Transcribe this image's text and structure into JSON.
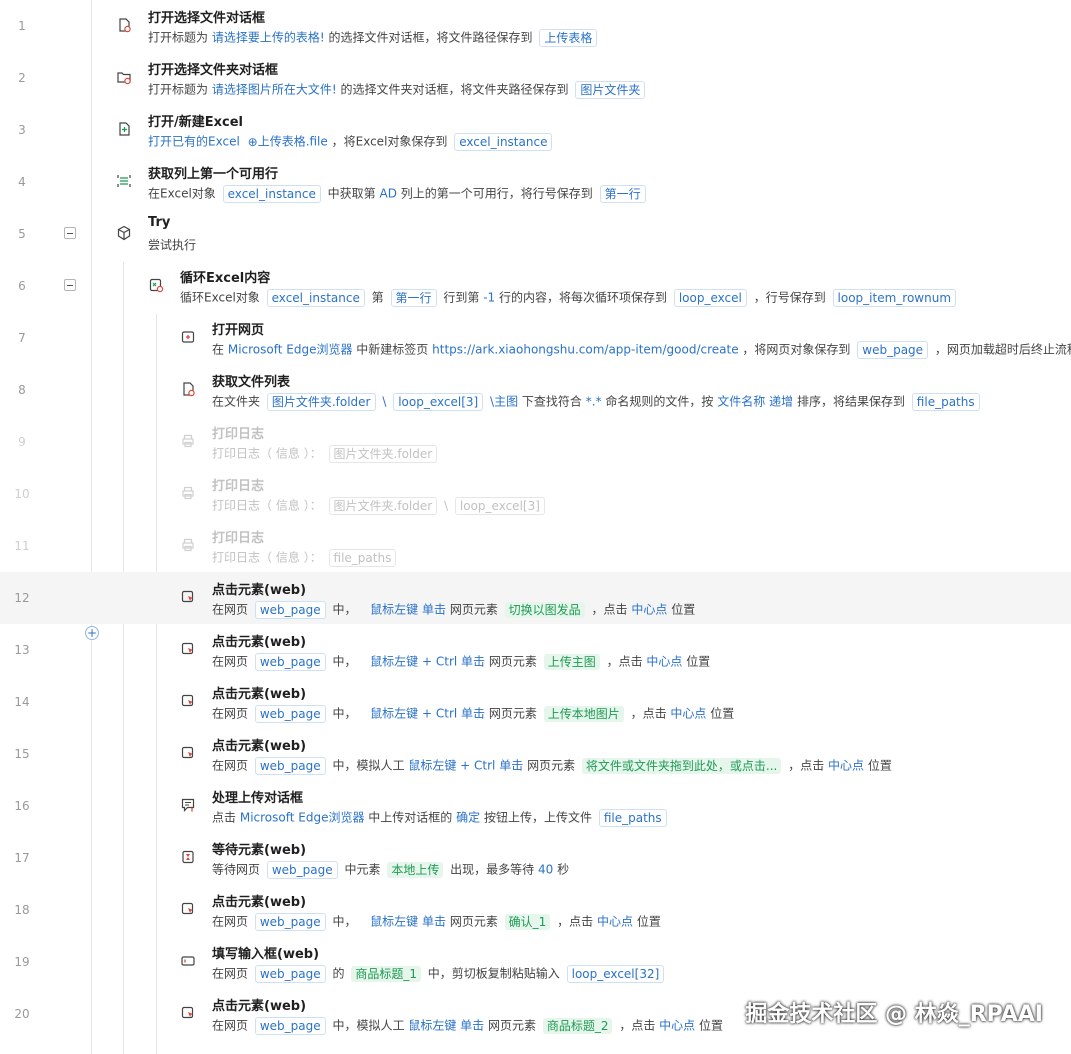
{
  "rows": [
    {
      "num": "1",
      "title": "打开选择文件对话框",
      "desc": {
        "a": "打开标题为",
        "b": "请选择要上传的表格!",
        "c": "的选择文件对话框，将文件路径保存到",
        "d": "上传表格"
      }
    },
    {
      "num": "2",
      "title": "打开选择文件夹对话框",
      "desc": {
        "a": "打开标题为",
        "b": "请选择图片所在大文件!",
        "c": "的选择文件夹对话框，将文件夹路径保存到",
        "d": "图片文件夹"
      }
    },
    {
      "num": "3",
      "title": "打开/新建Excel",
      "desc": {
        "a": "打开已有的Excel",
        "b": "上传表格.file",
        "c": "，将Excel对象保存到",
        "d": "excel_instance"
      }
    },
    {
      "num": "4",
      "title": "获取列上第一个可用行",
      "desc": {
        "a": "在Excel对象",
        "b": "excel_instance",
        "c": "中获取第",
        "d": "AD",
        "e": "列上的第一个可用行，将行号保存到",
        "f": "第一行"
      }
    },
    {
      "num": "5",
      "title": "Try",
      "desc": {
        "a": "尝试执行"
      }
    },
    {
      "num": "6",
      "title": "循环Excel内容",
      "desc": {
        "a": "循环Excel对象",
        "b": "excel_instance",
        "c": "第",
        "d": "第一行",
        "e": "行到第",
        "f": "-1",
        "g": "行的内容，将每次循环项保存到",
        "h": "loop_excel",
        "i": "，行号保存到",
        "j": "loop_item_rownum"
      }
    },
    {
      "num": "7",
      "title": "打开网页",
      "desc": {
        "a": "在",
        "b": "Microsoft Edge浏览器",
        "c": "中新建标签页",
        "d": "https://ark.xiaohongshu.com/app-item/good/create",
        "e": "，将网页对象保存到",
        "f": "web_page",
        "g": "，网页加载超时后终止流程"
      }
    },
    {
      "num": "8",
      "title": "获取文件列表",
      "desc": {
        "a": "在文件夹",
        "b": "图片文件夹.folder",
        "c": "\\",
        "d": "loop_excel[3]",
        "e": "\\主图",
        "f": "下查找符合",
        "g": "*.*",
        "h": "命名规则的文件，按",
        "i": "文件名称",
        "j": "递增",
        "k": "排序，将结果保存到",
        "l": "file_paths"
      }
    },
    {
      "num": "9",
      "title": "打印日志",
      "desc": {
        "a": "打印日志（",
        "b": "信息",
        "c": "）：",
        "d": "图片文件夹.folder"
      }
    },
    {
      "num": "10",
      "title": "打印日志",
      "desc": {
        "a": "打印日志（",
        "b": "信息",
        "c": "）：",
        "d": "图片文件夹.folder",
        "e": "\\",
        "f": "loop_excel[3]"
      }
    },
    {
      "num": "11",
      "title": "打印日志",
      "desc": {
        "a": "打印日志（",
        "b": "信息",
        "c": "）：",
        "d": "file_paths"
      }
    },
    {
      "num": "12",
      "title": "点击元素(web)",
      "desc": {
        "a": "在网页",
        "b": "web_page",
        "c": "中，",
        "d": "鼠标左键",
        "e": "单击",
        "f": "网页元素",
        "g": "切换以图发品",
        "h": "，点击",
        "i": "中心点",
        "j": "位置"
      }
    },
    {
      "num": "13",
      "title": "点击元素(web)",
      "desc": {
        "a": "在网页",
        "b": "web_page",
        "c": "中，",
        "d": "鼠标左键",
        "e": "+ Ctrl",
        "f": "单击",
        "g": "网页元素",
        "h": "上传主图",
        "i": "，点击",
        "j": "中心点",
        "k": "位置"
      }
    },
    {
      "num": "14",
      "title": "点击元素(web)",
      "desc": {
        "a": "在网页",
        "b": "web_page",
        "c": "中，",
        "d": "鼠标左键",
        "e": "+ Ctrl",
        "f": "单击",
        "g": "网页元素",
        "h": "上传本地图片",
        "i": "，点击",
        "j": "中心点",
        "k": "位置"
      }
    },
    {
      "num": "15",
      "title": "点击元素(web)",
      "desc": {
        "a": "在网页",
        "b": "web_page",
        "c": "中，模拟人工",
        "d": "鼠标左键",
        "e": "+ Ctrl",
        "f": "单击",
        "g": "网页元素",
        "h": "将文件或文件夹拖到此处，或点击...",
        "i": "，点击",
        "j": "中心点",
        "k": "位置"
      }
    },
    {
      "num": "16",
      "title": "处理上传对话框",
      "desc": {
        "a": "点击",
        "b": "Microsoft Edge浏览器",
        "c": "中上传对话框的",
        "d": "确定",
        "e": "按钮上传，上传文件",
        "f": "file_paths"
      }
    },
    {
      "num": "17",
      "title": "等待元素(web)",
      "desc": {
        "a": "等待网页",
        "b": "web_page",
        "c": "中元素",
        "d": "本地上传",
        "e": "出现，最多等待",
        "f": "40",
        "g": "秒"
      }
    },
    {
      "num": "18",
      "title": "点击元素(web)",
      "desc": {
        "a": "在网页",
        "b": "web_page",
        "c": "中，",
        "d": "鼠标左键",
        "e": "单击",
        "f": "网页元素",
        "g": "确认_1",
        "h": "，点击",
        "i": "中心点",
        "j": "位置"
      }
    },
    {
      "num": "19",
      "title": "填写输入框(web)",
      "desc": {
        "a": "在网页",
        "b": "web_page",
        "c": "的",
        "d": "商品标题_1",
        "e": "中，剪切板复制粘贴输入",
        "f": "loop_excel[32]"
      }
    },
    {
      "num": "20",
      "title": "点击元素(web)",
      "desc": {
        "a": "在网页",
        "b": "web_page",
        "c": "中，模拟人工",
        "d": "鼠标左键",
        "e": "单击",
        "f": "网页元素",
        "g": "商品标题_2",
        "h": "，点击",
        "i": "中心点",
        "j": "位置"
      }
    }
  ],
  "icons": [
    "file-dialog-icon",
    "folder-dialog-icon",
    "excel-open-icon",
    "excel-row-icon",
    "try-block-icon",
    "excel-loop-icon",
    "open-webpage-icon",
    "file-list-icon",
    "print-log-icon",
    "print-log-icon",
    "print-log-icon",
    "click-element-icon",
    "click-element-icon",
    "click-element-icon",
    "click-element-icon",
    "upload-dialog-icon",
    "wait-element-icon",
    "click-element-icon",
    "fill-input-icon",
    "click-element-icon"
  ],
  "add_step_symbol": "+",
  "watermark": "掘金技术社区 @ 林焱_RPAAI",
  "colors": {
    "accent": "#2a72c9",
    "green_chip": "#1f9a54",
    "disabled": "#c2c2c2"
  }
}
